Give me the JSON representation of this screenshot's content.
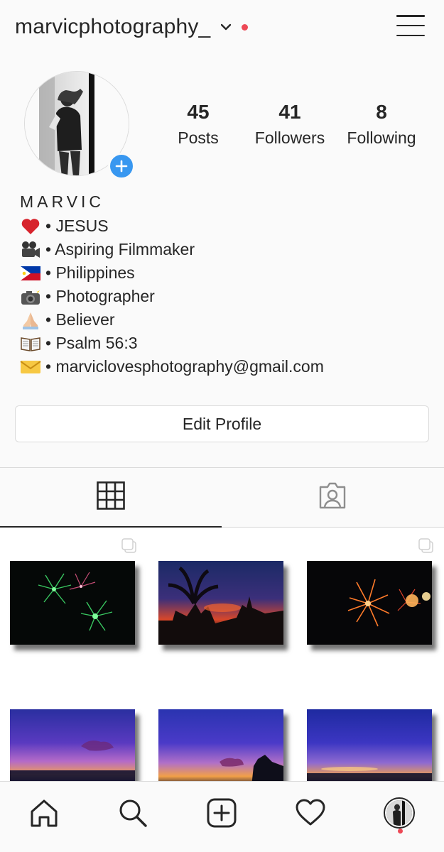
{
  "header": {
    "username": "marvicphotography_",
    "chevron_icon": "chevron-down-icon",
    "menu_icon": "hamburger-menu-icon",
    "notification_color": "#ed4956"
  },
  "profile": {
    "avatar_alt": "profile photo",
    "add_story_icon": "plus-icon",
    "stats": {
      "posts": {
        "value": "45",
        "label": "Posts"
      },
      "followers": {
        "value": "41",
        "label": "Followers"
      },
      "following": {
        "value": "8",
        "label": "Following"
      }
    }
  },
  "bio": {
    "name": "MARVIC",
    "lines": [
      {
        "emoji": "heart",
        "text": "• JESUS"
      },
      {
        "emoji": "movie-camera",
        "text": "• Aspiring Filmmaker"
      },
      {
        "emoji": "philippines-flag",
        "text": "• Philippines"
      },
      {
        "emoji": "camera-flash",
        "text": "• Photographer"
      },
      {
        "emoji": "folded-hands",
        "text": "• Believer"
      },
      {
        "emoji": "open-book",
        "text": "• Psalm 56:3"
      },
      {
        "emoji": "envelope",
        "text": "• marviclovesphotography@gmail.com"
      }
    ]
  },
  "actions": {
    "edit_profile": "Edit Profile"
  },
  "tabs": [
    {
      "name": "grid",
      "icon": "grid-icon",
      "active": true
    },
    {
      "name": "tagged",
      "icon": "tagged-person-icon",
      "active": false
    }
  ],
  "posts": [
    {
      "subject": "green fireworks",
      "multiple": true
    },
    {
      "subject": "sunset silhouette",
      "multiple": false
    },
    {
      "subject": "orange fireworks",
      "multiple": true
    },
    {
      "subject": "purple sunset sea",
      "multiple": false
    },
    {
      "subject": "purple sunset clouds",
      "multiple": false
    },
    {
      "subject": "purple sunset horizon",
      "multiple": false
    }
  ],
  "bottom_nav": [
    {
      "name": "home",
      "icon": "home-icon"
    },
    {
      "name": "search",
      "icon": "search-icon"
    },
    {
      "name": "new-post",
      "icon": "plus-square-icon"
    },
    {
      "name": "activity",
      "icon": "heart-icon"
    },
    {
      "name": "profile",
      "icon": "profile-avatar-icon"
    }
  ],
  "colors": {
    "accent_blue": "#3897f0",
    "notification_red": "#ed4956",
    "text": "#262626",
    "border": "#dbdbdb"
  }
}
